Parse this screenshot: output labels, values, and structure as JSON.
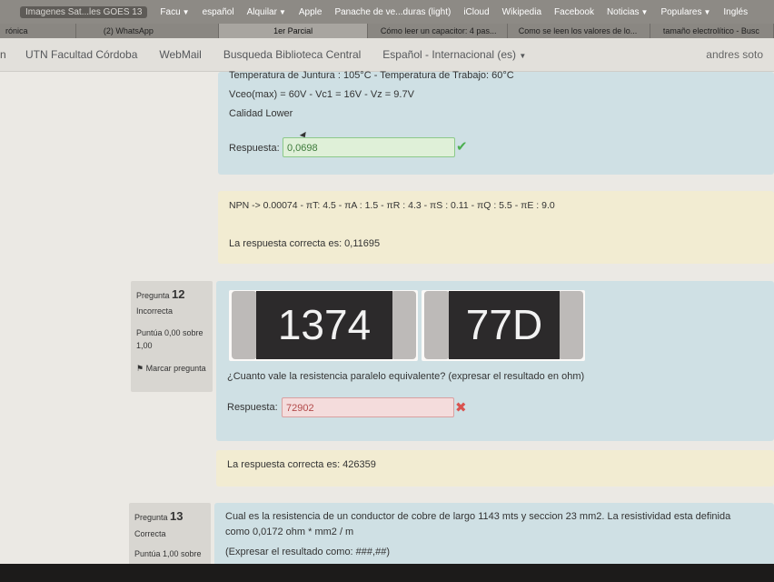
{
  "browser": {
    "bookmarks": [
      {
        "label": "Imagenes Sat...les GOES 13"
      },
      {
        "label": "Facu",
        "dropdown": true
      },
      {
        "label": "español"
      },
      {
        "label": "Alquilar",
        "dropdown": true
      },
      {
        "label": "Apple"
      },
      {
        "label": "Panache de ve...duras (light)"
      },
      {
        "label": "iCloud"
      },
      {
        "label": "Wikipedia"
      },
      {
        "label": "Facebook"
      },
      {
        "label": "Noticias",
        "dropdown": true
      },
      {
        "label": "Populares",
        "dropdown": true
      },
      {
        "label": "Inglés"
      }
    ],
    "tabs": [
      "rónica",
      "(2) WhatsApp",
      "1er Parcial",
      "Cómo leer un capacitor: 4 pas...",
      "Como se leen los valores de lo...",
      "tamaño electrolítico - Busc"
    ],
    "active_tab_index": 2
  },
  "site": {
    "nav": [
      "UTN Facultad Córdoba",
      "WebMail",
      "Busqueda Biblioteca Central",
      "Español - Internacional (es)"
    ],
    "user": "andres soto"
  },
  "q_prev": {
    "line1": "Temperatura de Juntura : 105°C  - Temperatura de Trabajo: 60°C",
    "line2": "Vceo(max) = 60V - Vc1 = 16V - Vz = 9.7V",
    "line3": "Calidad Lower",
    "answer_label": "Respuesta:",
    "answer_value": "0,0698",
    "feedback": "NPN -> 0.00074   - πT: 4.5  - πA : 1.5 - πR : 4.3 - πS : 0.11 - πQ : 5.5  - πE : 9.0",
    "correct": "La respuesta correcta es: 0,11695"
  },
  "q12": {
    "label": "Pregunta",
    "number": "12",
    "status": "Incorrecta",
    "score": "Puntúa 0,00 sobre 1,00",
    "flag": "Marcar pregunta",
    "resistor1": "1374",
    "resistor2": "77D",
    "question": "¿Cuanto vale la resistencia paralelo equivalente? (expresar el resultado en ohm)",
    "answer_label": "Respuesta:",
    "answer_value": "72902",
    "correct": "La respuesta correcta es: 426359"
  },
  "q13": {
    "label": "Pregunta",
    "number": "13",
    "status": "Correcta",
    "score": "Puntúa 1,00 sobre",
    "text1": "Cual es la resistencia de un conductor de cobre de largo 1143 mts y seccion 23 mm2. La resistividad esta definida",
    "text2": "como 0,0172 ohm * mm2 / m",
    "text3": "(Expresar el resultado como: ###,##)"
  },
  "colors": {
    "correct": "#4caf50",
    "incorrect": "#d9534f"
  }
}
